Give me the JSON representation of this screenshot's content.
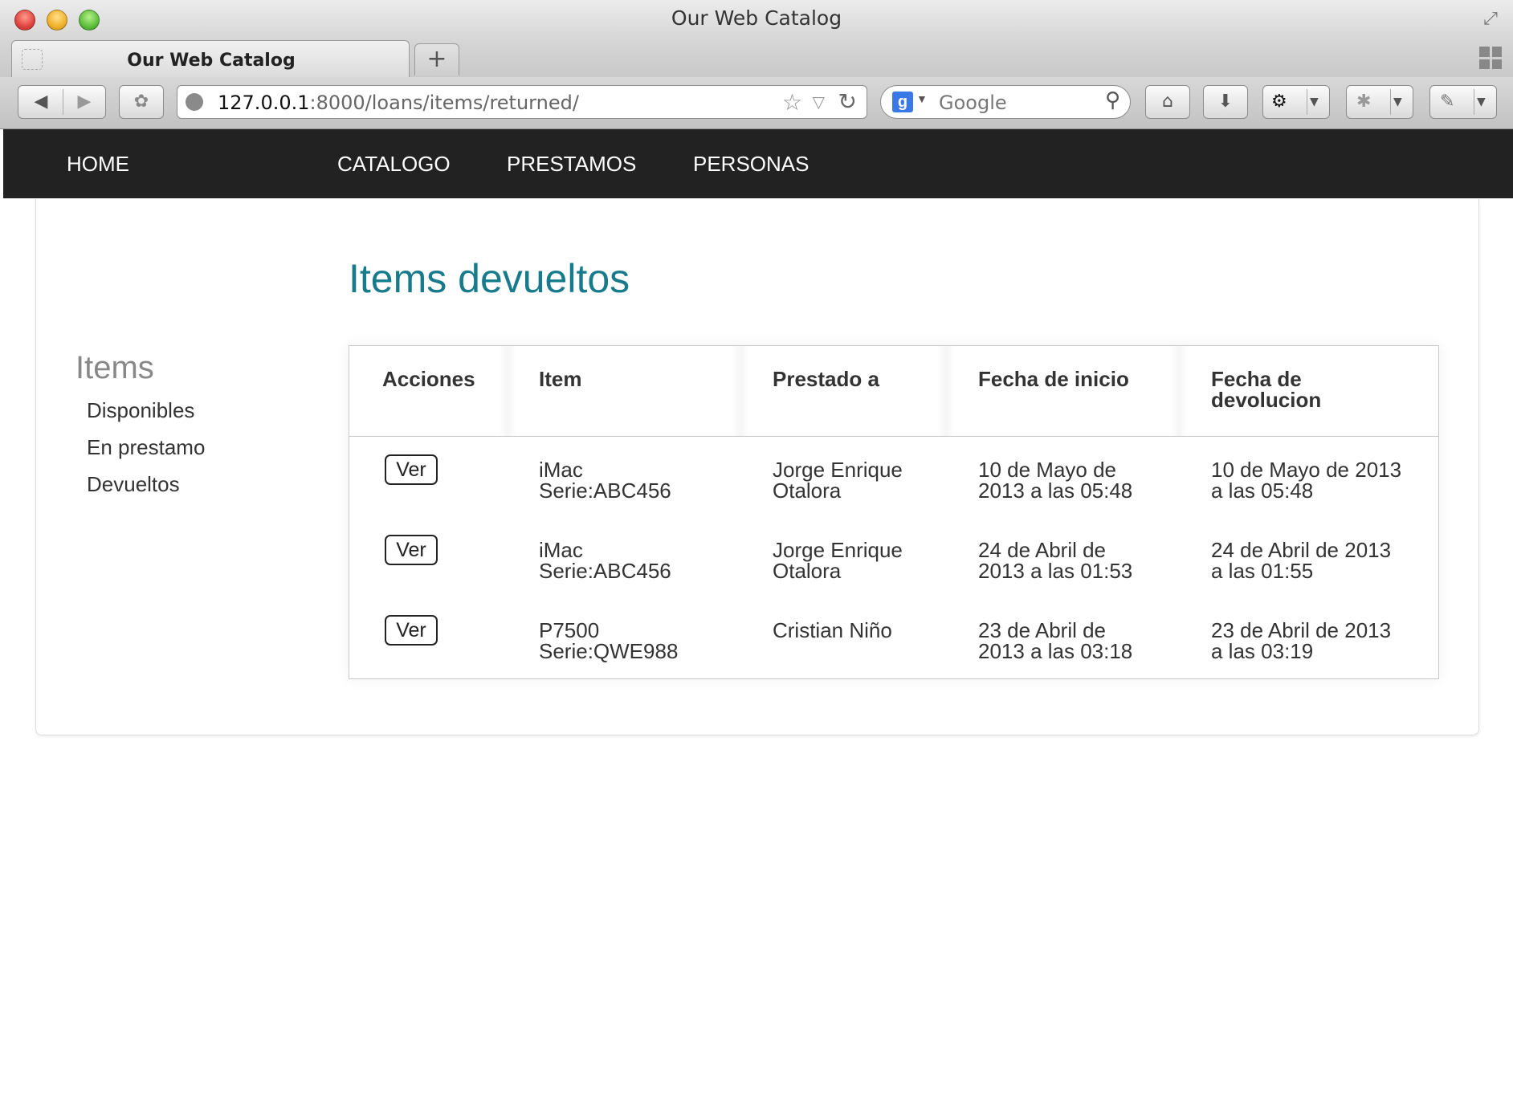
{
  "window": {
    "title": "Our Web Catalog"
  },
  "tab": {
    "title": "Our Web Catalog"
  },
  "address": {
    "host": "127.0.0.1",
    "rest": ":8000/loans/items/returned/"
  },
  "search": {
    "placeholder": "Google",
    "engine_letter": "g"
  },
  "site_nav": {
    "home": "HOME",
    "catalogo": "CATALOGO",
    "prestamos": "PRESTAMOS",
    "personas": "PERSONAS"
  },
  "page": {
    "title": "Items devueltos"
  },
  "sidebar": {
    "title": "Items",
    "links": [
      "Disponibles",
      "En prestamo",
      "Devueltos"
    ]
  },
  "table": {
    "headers": {
      "acciones": "Acciones",
      "item": "Item",
      "prestado": "Prestado a",
      "inicio": "Fecha de inicio",
      "devolucion_1": "Fecha de",
      "devolucion_2": "devolucion"
    },
    "rows": [
      {
        "action": "Ver",
        "item_1": "iMac",
        "item_2": "Serie:ABC456",
        "person_1": "Jorge Enrique",
        "person_2": "Otalora",
        "start_1": "10 de Mayo de",
        "start_2": "2013 a las 05:48",
        "return_1": "10 de Mayo de 2013",
        "return_2": "a las 05:48"
      },
      {
        "action": "Ver",
        "item_1": "iMac",
        "item_2": "Serie:ABC456",
        "person_1": "Jorge Enrique",
        "person_2": "Otalora",
        "start_1": "24 de Abril de",
        "start_2": "2013 a las 01:53",
        "return_1": "24 de Abril de 2013",
        "return_2": "a las 01:55"
      },
      {
        "action": "Ver",
        "item_1": "P7500",
        "item_2": "Serie:QWE988",
        "person_1": "Cristian Niño",
        "person_2": "",
        "start_1": "23 de Abril de",
        "start_2": "2013 a las 03:18",
        "return_1": "23 de Abril de 2013",
        "return_2": "a las 03:19"
      }
    ]
  },
  "colors": {
    "nav_bg": "#222222",
    "title_accent": "#177b8c"
  }
}
